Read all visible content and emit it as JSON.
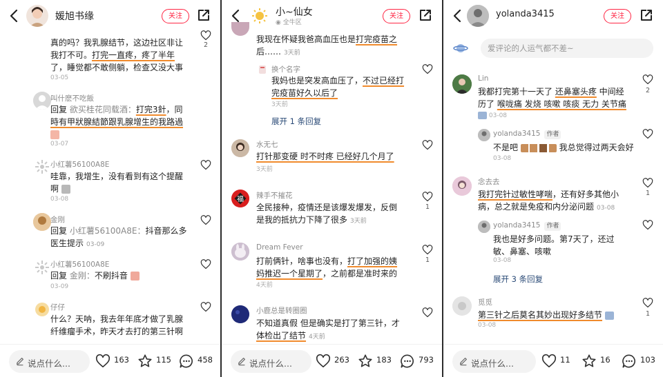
{
  "panels": [
    {
      "title": "媛旭书缘",
      "follow": "关注",
      "comment_placeholder": "说点什么...",
      "stats": {
        "likes": "163",
        "collects": "115",
        "comments": "458"
      },
      "comments": {
        "c1": {
          "text_a": "真的吗？我乳腺结节，这边社区非让",
          "text_b": "我打不可。",
          "hl": "打完一直疼，疼了半年",
          "text_c": "了，睡觉都不敢侧躺，检查又没大事",
          "date": "03-05",
          "likes": "2"
        },
        "c2": {
          "user": "叫什麽不吃飯",
          "reply_word": "回复",
          "mention": "欲买桂花同载酒：",
          "hl1": "打完3針",
          "tail1": "，同",
          "hl2": "時有甲狀腺結節跟乳腺增生的我路過",
          "date": "03-07"
        },
        "c3": {
          "user": "小红薯56100A8E",
          "text_a": "哇靠，我增生，没有看到有这个提醒",
          "text_b": "啊",
          "date": "03-08"
        },
        "c4": {
          "user": "金刚",
          "reply_word": "回复",
          "mention": "小红薯56100A8E：",
          "text_a": "抖音那么多",
          "text_b": "医生提示",
          "date": "03-09"
        },
        "c5": {
          "user": "小红薯56100A8E",
          "reply_word": "回复",
          "mention": "金刚：",
          "text_a": "不刷抖音",
          "date": "03-09"
        },
        "c6": {
          "user": "仔仔",
          "text_a": "什么？天呐，我去年年底才做了乳腺",
          "text_b": "纤维瘤手术，昨天才去打的第三针啊"
        }
      }
    },
    {
      "title": "小~仙女",
      "subtitle": "全牛区",
      "follow": "关注",
      "comment_placeholder": "说点什么...",
      "stats": {
        "likes": "263",
        "collects": "183",
        "comments": "793"
      },
      "comments": {
        "c1": {
          "text_a": "我现在怀疑我爸高血压也是",
          "hl": "打完疫苗之",
          "text_b": "后……",
          "meta": "3天前"
        },
        "c2": {
          "user": "换个名字",
          "text_a": "我妈也是突发高血压了，",
          "hl": "不过已经打",
          "hl2": "完疫苗好久以后了",
          "date": "3天前"
        },
        "expand": "展开 1 条回复",
        "c3": {
          "user": "水无七",
          "hl": "打针那变硬 时不时疼 已经好几个月了",
          "date": "3天前"
        },
        "c4": {
          "user": "辣手不摧花",
          "text_a": "全民接种，疫情还是该爆发爆发，反倒",
          "text_b": "是我的抵抗力下降了很多",
          "meta": "3天前",
          "likes": "1"
        },
        "c5": {
          "user": "Dream Fever",
          "text_a": "打前俩针，啥事也没有，",
          "hl": "打了加强的姨",
          "hl2": "妈推迟一个星期了",
          "text_b": "，之前都是准时来的",
          "date": "4天前",
          "likes": "1"
        },
        "c6": {
          "user": "小鹿总是转圈圈",
          "text_a": "不知道真假 但是确实是打了第三针，才",
          "hl": "体检出了结节",
          "meta": "4天前"
        }
      }
    },
    {
      "title": "yolanda3415",
      "follow": "关注",
      "comment_bar": "爱评论的人运气都不差~",
      "comment_placeholder": "说点什么...",
      "stats": {
        "likes": "11",
        "collects": "16",
        "comments": "103"
      },
      "comments": {
        "c1": {
          "user": "Lin",
          "text_a": "我都打完第十一天了 ",
          "hl": "还鼻塞头疼",
          "text_b": " 中间经",
          "text_c": "历了 ",
          "hl2": "喉咙痛 发烧 咳嗽 咳痰 无力 关节痛",
          "date": "03-08",
          "likes": "2"
        },
        "c2": {
          "user": "yolanda3415",
          "tag": "作者",
          "text_a": "不是吧",
          "text_b": "我总觉得过两天会好",
          "date": "03-08"
        },
        "c3": {
          "user": "念去去",
          "hl": "我打完针过敏性哮喘",
          "text_a": "，还有好多其他小",
          "text_b": "病，总之就是免疫和内分泌问题",
          "meta": "03-08",
          "likes": "1"
        },
        "c4": {
          "user": "yolanda3415",
          "tag": "作者",
          "text_a": "我也是好多问题。第7天了，还过",
          "text_b": "敏、鼻塞、咳嗽",
          "date": "03-08"
        },
        "expand": "展开 3 条回复",
        "c5": {
          "user": "觅觅",
          "hl": "第三针之后莫名其妙出现好多结节",
          "date": "03-08",
          "likes": "1"
        }
      }
    }
  ]
}
